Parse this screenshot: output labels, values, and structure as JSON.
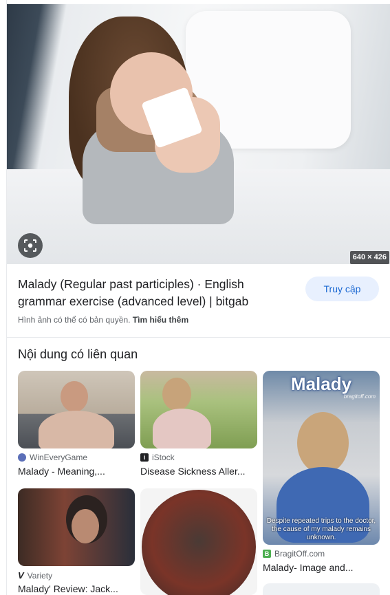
{
  "hero": {
    "dimensions": "640 × 426",
    "lens_icon": "image-search-icon"
  },
  "result": {
    "title": "Malady (Regular past participles) · English grammar exercise (advanced level) | bitgab",
    "visit_label": "Truy cập",
    "copyright_text": "Hình ảnh có thể có bản quyền.",
    "learn_more": "Tìm hiểu thêm"
  },
  "related": {
    "heading": "Nội dung có liên quan",
    "items": [
      {
        "source": "WinEveryGame",
        "caption": "Malady - Meaning,...",
        "favicon_color": "#5b6fb8"
      },
      {
        "source": "iStock",
        "caption": "Disease Sickness Aller...",
        "favicon_color": "#202124"
      },
      {
        "source": "BragitOff.com",
        "caption": "Malady- Image and...",
        "favicon_color": "#4caf50",
        "image_title": "Malady",
        "image_sub": "bragitoff.com",
        "image_quote": "Despite repeated trips to the doctor, the cause of my malady remains unknown."
      },
      {
        "source": "Variety",
        "caption": "Malady' Review: Jack...",
        "favicon_color": "#ffffff"
      }
    ]
  }
}
